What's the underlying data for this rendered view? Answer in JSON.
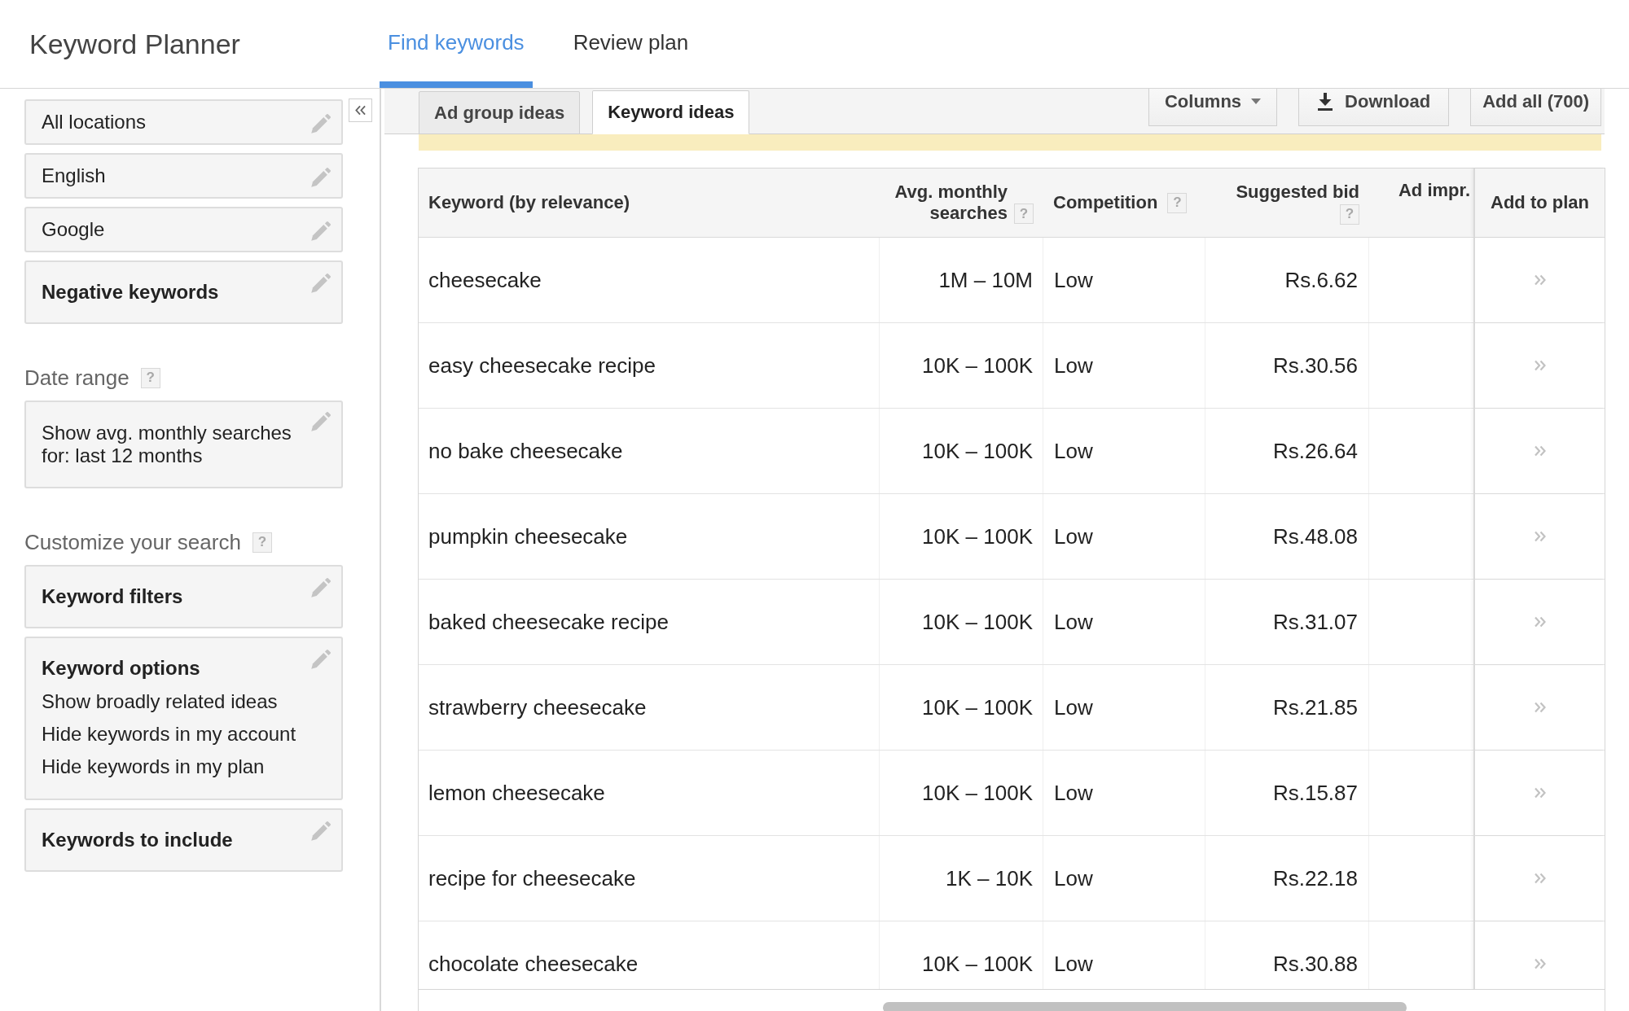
{
  "app": {
    "title": "Keyword Planner"
  },
  "nav_tabs": [
    {
      "label": "Find keywords",
      "selected": true
    },
    {
      "label": "Review plan",
      "selected": false
    }
  ],
  "sidebar": {
    "groups": [
      {
        "cards": [
          {
            "kind": "setting",
            "text": "All locations"
          },
          {
            "kind": "setting",
            "text": "English"
          },
          {
            "kind": "setting",
            "text": "Google"
          },
          {
            "kind": "heading",
            "text": "Negative keywords"
          }
        ]
      },
      {
        "title": "Date range",
        "help": "?",
        "cards": [
          {
            "kind": "text",
            "text": "Show avg. monthly searches for: last 12 months"
          }
        ]
      },
      {
        "title": "Customize your search",
        "help": "?",
        "cards": [
          {
            "kind": "heading",
            "text": "Keyword filters"
          },
          {
            "kind": "heading",
            "text": "Keyword options",
            "lines": [
              "Show broadly related ideas",
              "Hide keywords in my account",
              "Hide keywords in my plan"
            ]
          },
          {
            "kind": "heading",
            "text": "Keywords to include"
          }
        ]
      }
    ]
  },
  "sub_tabs": [
    {
      "label": "Ad group ideas",
      "selected": false
    },
    {
      "label": "Keyword ideas",
      "selected": true
    }
  ],
  "toolbar": [
    {
      "kind": "menu",
      "label": "Columns"
    },
    {
      "kind": "download",
      "label": "Download"
    },
    {
      "kind": "plain",
      "label": "Add all (700)"
    }
  ],
  "table": {
    "columns": [
      {
        "label": "Keyword (by relevance)"
      },
      {
        "label": "Avg. monthly searches",
        "help": "?"
      },
      {
        "label": "Competition",
        "help": "?"
      },
      {
        "label": "Suggested bid",
        "help": "?"
      },
      {
        "label": "Ad impr."
      },
      {
        "label": "Add to plan"
      }
    ],
    "rows": [
      {
        "keyword": "cheesecake",
        "searches": "1M – 10M",
        "competition": "Low",
        "bid": "Rs.6.62"
      },
      {
        "keyword": "easy cheesecake recipe",
        "searches": "10K – 100K",
        "competition": "Low",
        "bid": "Rs.30.56"
      },
      {
        "keyword": "no bake cheesecake",
        "searches": "10K – 100K",
        "competition": "Low",
        "bid": "Rs.26.64"
      },
      {
        "keyword": "pumpkin cheesecake",
        "searches": "10K – 100K",
        "competition": "Low",
        "bid": "Rs.48.08"
      },
      {
        "keyword": "baked cheesecake recipe",
        "searches": "10K – 100K",
        "competition": "Low",
        "bid": "Rs.31.07"
      },
      {
        "keyword": "strawberry cheesecake",
        "searches": "10K – 100K",
        "competition": "Low",
        "bid": "Rs.21.85"
      },
      {
        "keyword": "lemon cheesecake",
        "searches": "10K – 100K",
        "competition": "Low",
        "bid": "Rs.15.87"
      },
      {
        "keyword": "recipe for cheesecake",
        "searches": "1K – 10K",
        "competition": "Low",
        "bid": "Rs.22.18"
      },
      {
        "keyword": "chocolate cheesecake",
        "searches": "10K – 100K",
        "competition": "Low",
        "bid": "Rs.30.88"
      }
    ]
  }
}
